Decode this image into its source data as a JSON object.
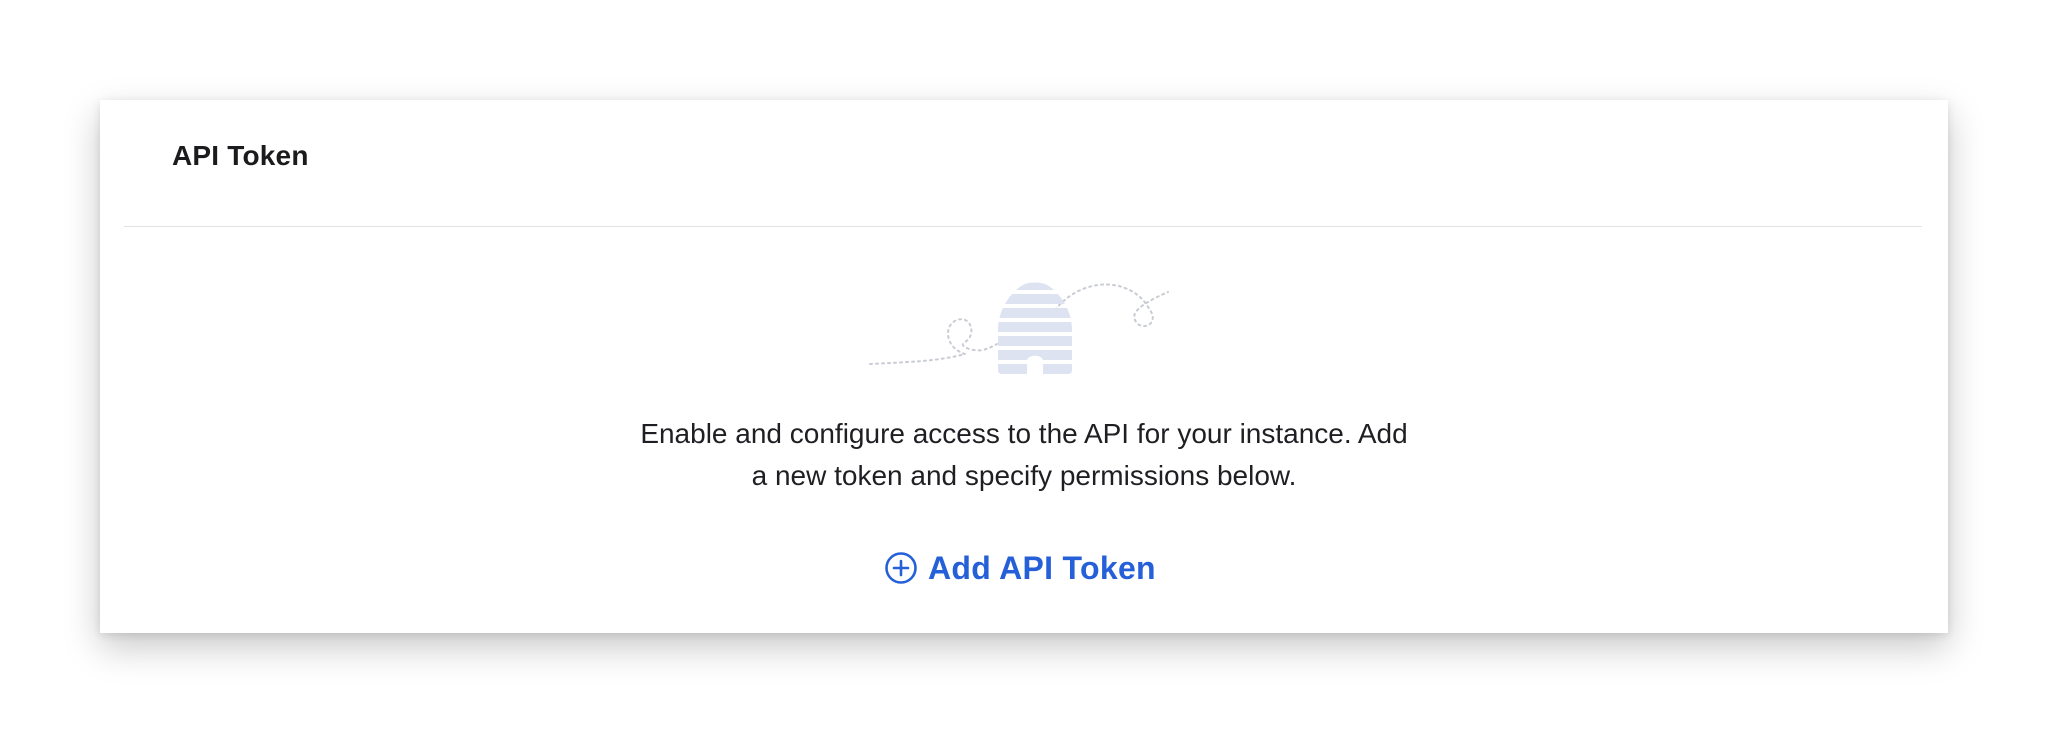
{
  "card": {
    "title": "API Token"
  },
  "empty_state": {
    "illustration": "beehive-illustration",
    "line1": "Enable and configure access to the API for your instance. Add",
    "line2": "a new token and specify permissions below."
  },
  "actions": {
    "add_token_label": "Add API Token",
    "add_token_icon": "plus-circle-icon"
  },
  "colors": {
    "accent": "#2660d9",
    "illustration": "#dde3f1",
    "text": "#1f1f23"
  }
}
